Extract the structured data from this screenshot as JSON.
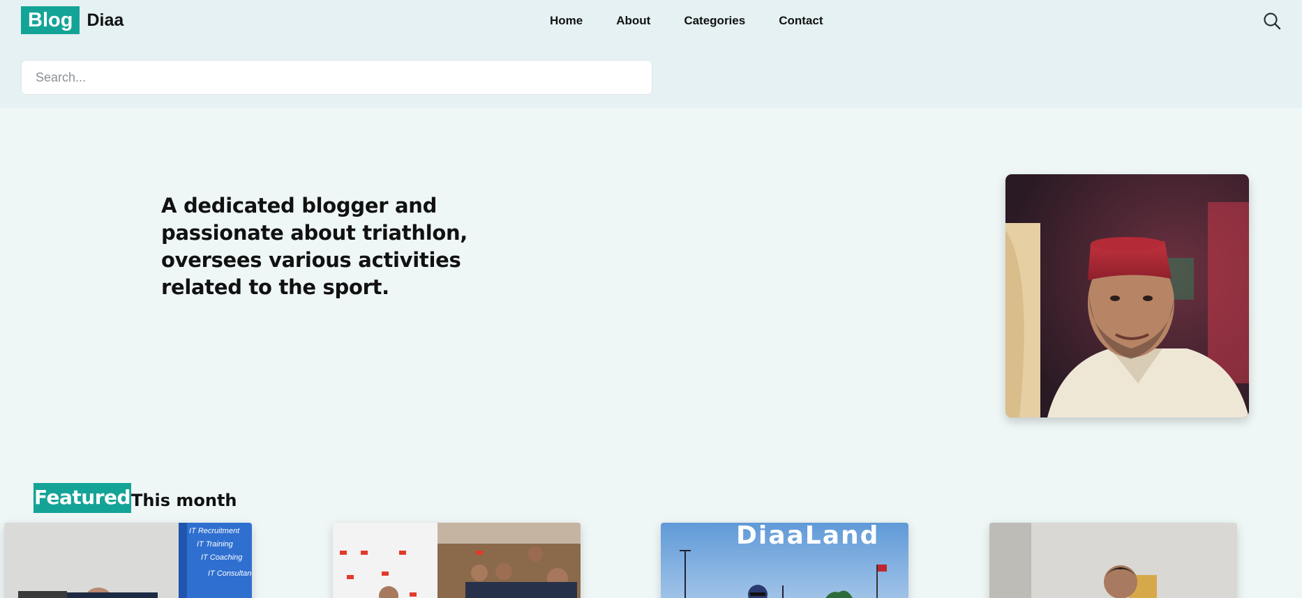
{
  "header": {
    "logo_badge": "Blog",
    "logo_text": "Diaa",
    "nav": [
      "Home",
      "About",
      "Categories",
      "Contact"
    ],
    "search_icon": "search-icon"
  },
  "search": {
    "placeholder": "Search...",
    "value": ""
  },
  "hero": {
    "text": "A dedicated blogger and passionate about triathlon, oversees various activities related to the sport."
  },
  "featured": {
    "badge": "Featured",
    "subtitle": "This month",
    "cards": [
      {
        "image_text": [
          "IT Recruitment",
          "IT Training",
          "IT Coaching",
          "IT Consultancy"
        ]
      },
      {
        "image_text": []
      },
      {
        "image_text": [
          "DiaaLand"
        ]
      },
      {
        "image_text": []
      }
    ]
  },
  "colors": {
    "accent": "#14a497",
    "header_bg": "#e5f1f2",
    "page_bg": "#eef6f6"
  }
}
